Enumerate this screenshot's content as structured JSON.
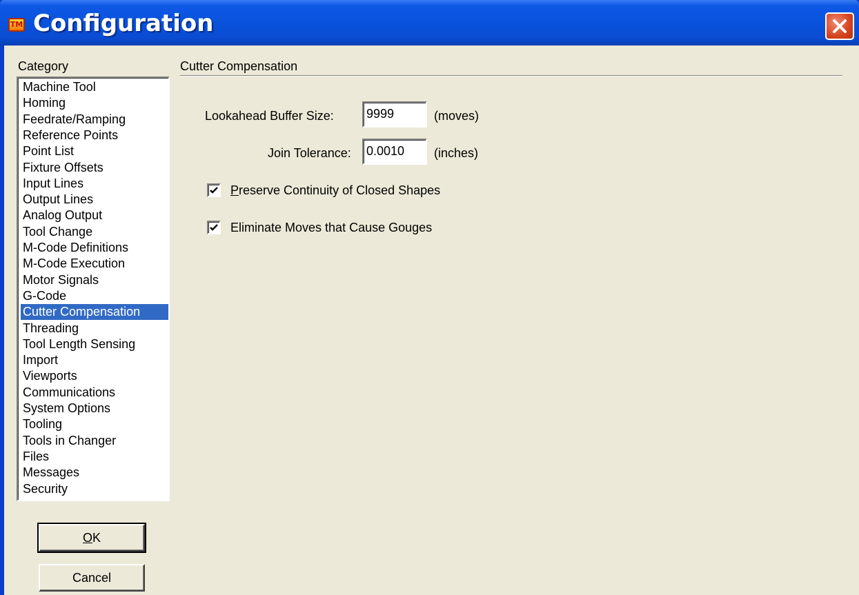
{
  "window": {
    "title": "Configuration",
    "app_icon_text": "TM",
    "close_icon": "close-icon"
  },
  "category": {
    "label": "Category",
    "items": [
      "Machine Tool",
      "Homing",
      "Feedrate/Ramping",
      "Reference Points",
      "Point List",
      "Fixture Offsets",
      "Input Lines",
      "Output Lines",
      "Analog Output",
      "Tool Change",
      "M-Code Definitions",
      "M-Code Execution",
      "Motor Signals",
      "G-Code",
      "Cutter Compensation",
      "Threading",
      "Tool Length Sensing",
      "Import",
      "Viewports",
      "Communications",
      "System Options",
      "Tooling",
      "Tools in Changer",
      "Files",
      "Messages",
      "Security"
    ],
    "selected": "Cutter Compensation"
  },
  "buttons": {
    "ok_mnemonic": "O",
    "ok_rest": "K",
    "cancel": "Cancel"
  },
  "section": {
    "title": "Cutter Compensation",
    "lookahead": {
      "label": "Lookahead Buffer Size:",
      "value": "9999",
      "unit": "(moves)"
    },
    "join": {
      "label": "Join Tolerance:",
      "value": "0.0010",
      "unit": "(inches)"
    },
    "preserve": {
      "mnemonic": "P",
      "rest": "reserve Continuity of Closed Shapes",
      "checked": true
    },
    "eliminate": {
      "label": "Eliminate Moves that Cause Gouges",
      "checked": true
    }
  },
  "colors": {
    "titlebar": "#0852dc",
    "selection": "#316ac5",
    "face": "#ece9d8",
    "close": "#d4441f"
  }
}
